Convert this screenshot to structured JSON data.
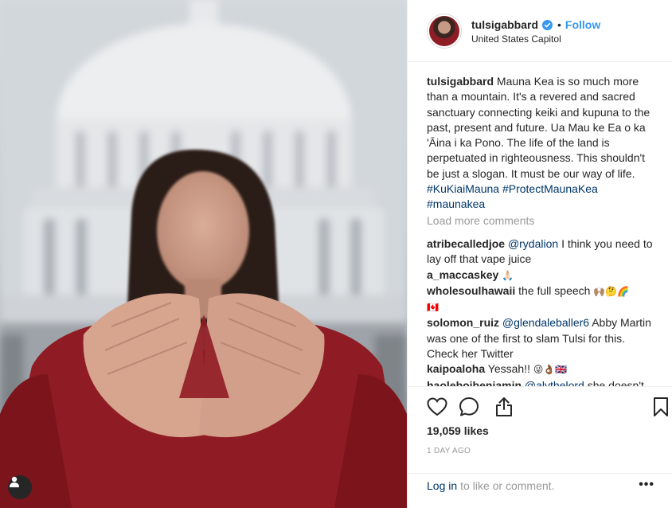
{
  "post": {
    "username": "tulsigabbard",
    "follow_label": "Follow",
    "separator": "•",
    "location": "United States Capitol"
  },
  "caption": {
    "username": "tulsigabbard",
    "text": "Mauna Kea is so much more than a mountain. It's a revered and sacred sanctuary connecting keiki and kupuna to the past, present and future. Ua Mau ke Ea o ka 'Āina i ka Pono. The life of the land is perpetuated in righteousness. This shouldn't be just a slogan. It must be our way of life.",
    "hashtags": [
      "#KuKiaiMauna",
      "#ProtectMaunaKea",
      "#maunakea"
    ]
  },
  "load_more": "Load more comments",
  "comments": [
    {
      "user": "atribecalledjoe",
      "mention": "@rydalion",
      "text": "I think you need to lay off that vape juice",
      "emoji": ""
    },
    {
      "user": "a_maccaskey",
      "mention": "",
      "text": "",
      "emoji": "🙏🏻"
    },
    {
      "user": "wholesoulhawaii",
      "mention": "",
      "text": "the full speech",
      "emoji": "🙌🏽🤔🌈",
      "flag": "🇨🇦"
    },
    {
      "user": "solomon_ruiz",
      "mention": "@glendaleballer6",
      "text": "Abby Martin was one of the first to slam Tulsi for this. Check her Twitter",
      "emoji": ""
    },
    {
      "user": "kaipoaloha",
      "mention": "",
      "text": "Yessah!!",
      "emoji": "😜👌🏾🇬🇧"
    },
    {
      "user": "haoleboibenjamin",
      "mention": "@alythelord",
      "text": "she doesn't",
      "emoji": ""
    }
  ],
  "engagement": {
    "likes": "19,059 likes",
    "time_ago": "1 DAY AGO"
  },
  "footer": {
    "login_link": "Log in",
    "login_suffix": "to like or comment.",
    "more": "•••"
  },
  "colors": {
    "accent": "#3897f0",
    "link": "#003569",
    "muted": "#999999",
    "text": "#262626"
  }
}
